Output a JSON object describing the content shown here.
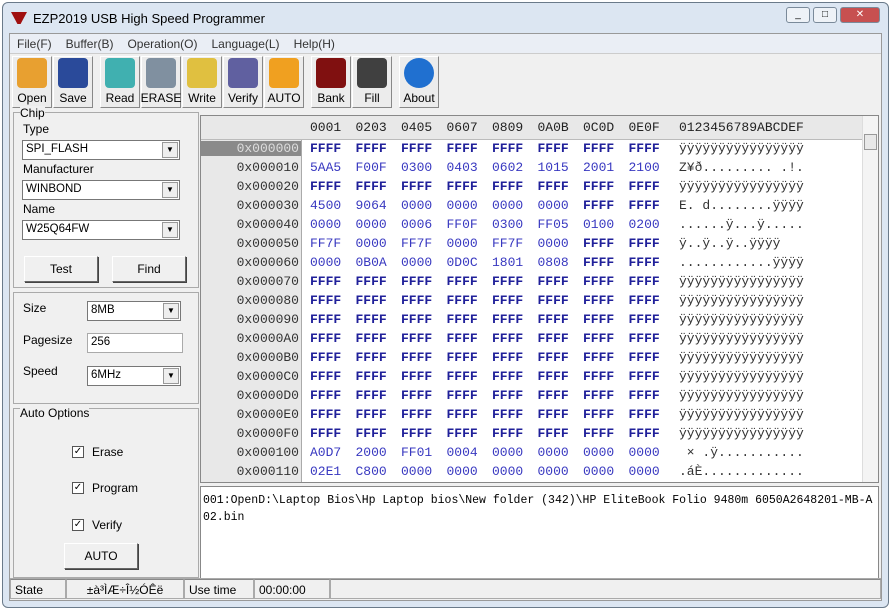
{
  "title": "EZP2019 USB High Speed Programmer",
  "window_controls": [
    "_",
    "□",
    "✕"
  ],
  "menu": [
    "File(F)",
    "Buffer(B)",
    "Operation(O)",
    "Language(L)",
    "Help(H)"
  ],
  "toolbar": [
    {
      "label": "Open",
      "icon": "folder-open-icon",
      "color": "#e8a030"
    },
    {
      "label": "Save",
      "icon": "floppy-disk-icon",
      "color": "#2a4a9a"
    },
    {
      "label": "Read",
      "icon": "notepad-icon",
      "color": "#40b0b0"
    },
    {
      "label": "ERASE",
      "icon": "trash-can-icon",
      "color": "#8090a0"
    },
    {
      "label": "Write",
      "icon": "folder-arrow-icon",
      "color": "#e0c040"
    },
    {
      "label": "Verify",
      "icon": "magnifier-icon",
      "color": "#6060a0"
    },
    {
      "label": "AUTO",
      "icon": "running-man-icon",
      "color": "#f0a020"
    },
    {
      "label": "Bank",
      "icon": "chip-info-icon",
      "color": "#801010"
    },
    {
      "label": "Fill",
      "icon": "bucket-icon",
      "color": "#404040"
    },
    {
      "label": "About",
      "icon": "help-icon",
      "color": "#2070d0"
    }
  ],
  "chip": {
    "group": "Chip",
    "type_label": "Type",
    "type": "SPI_FLASH",
    "manufacturer_label": "Manufacturer",
    "manufacturer": "WINBOND",
    "name_label": "Name",
    "name": "W25Q64FW",
    "test": "Test",
    "find": "Find"
  },
  "settings": {
    "size_label": "Size",
    "size": "8MB",
    "pagesize_label": "Pagesize",
    "pagesize": "256",
    "speed_label": "Speed",
    "speed": "6MHz"
  },
  "auto_options": {
    "group": "Auto Options",
    "erase": "Erase",
    "program": "Program",
    "verify": "Verify",
    "erase_checked": true,
    "program_checked": true,
    "verify_checked": true,
    "auto": "AUTO"
  },
  "hex": {
    "header_cols": [
      "0001",
      "0203",
      "0405",
      "0607",
      "0809",
      "0A0B",
      "0C0D",
      "0E0F"
    ],
    "header_ascii": "0123456789ABCDEF",
    "rows": [
      {
        "addr": "0x000000",
        "words": [
          "FFFF",
          "FFFF",
          "FFFF",
          "FFFF",
          "FFFF",
          "FFFF",
          "FFFF",
          "FFFF"
        ],
        "ascii": "ÿÿÿÿÿÿÿÿÿÿÿÿÿÿÿÿ"
      },
      {
        "addr": "0x000010",
        "words": [
          "5AA5",
          "F00F",
          "0300",
          "0403",
          "0602",
          "1015",
          "2001",
          "2100"
        ],
        "ascii": "Z¥ð......... .!."
      },
      {
        "addr": "0x000020",
        "words": [
          "FFFF",
          "FFFF",
          "FFFF",
          "FFFF",
          "FFFF",
          "FFFF",
          "FFFF",
          "FFFF"
        ],
        "ascii": "ÿÿÿÿÿÿÿÿÿÿÿÿÿÿÿÿ"
      },
      {
        "addr": "0x000030",
        "words": [
          "4500",
          "9064",
          "0000",
          "0000",
          "0000",
          "0000",
          "FFFF",
          "FFFF"
        ],
        "ascii": "E. d........ÿÿÿÿ"
      },
      {
        "addr": "0x000040",
        "words": [
          "0000",
          "0000",
          "0006",
          "FF0F",
          "0300",
          "FF05",
          "0100",
          "0200"
        ],
        "ascii": "......ÿ...ÿ....."
      },
      {
        "addr": "0x000050",
        "words": [
          "FF7F",
          "0000",
          "FF7F",
          "0000",
          "FF7F",
          "0000",
          "FFFF",
          "FFFF"
        ],
        "ascii": "ÿ..ÿ..ÿ..ÿÿÿÿ"
      },
      {
        "addr": "0x000060",
        "words": [
          "0000",
          "0B0A",
          "0000",
          "0D0C",
          "1801",
          "0808",
          "FFFF",
          "FFFF"
        ],
        "ascii": "............ÿÿÿÿ"
      },
      {
        "addr": "0x000070",
        "words": [
          "FFFF",
          "FFFF",
          "FFFF",
          "FFFF",
          "FFFF",
          "FFFF",
          "FFFF",
          "FFFF"
        ],
        "ascii": "ÿÿÿÿÿÿÿÿÿÿÿÿÿÿÿÿ"
      },
      {
        "addr": "0x000080",
        "words": [
          "FFFF",
          "FFFF",
          "FFFF",
          "FFFF",
          "FFFF",
          "FFFF",
          "FFFF",
          "FFFF"
        ],
        "ascii": "ÿÿÿÿÿÿÿÿÿÿÿÿÿÿÿÿ"
      },
      {
        "addr": "0x000090",
        "words": [
          "FFFF",
          "FFFF",
          "FFFF",
          "FFFF",
          "FFFF",
          "FFFF",
          "FFFF",
          "FFFF"
        ],
        "ascii": "ÿÿÿÿÿÿÿÿÿÿÿÿÿÿÿÿ"
      },
      {
        "addr": "0x0000A0",
        "words": [
          "FFFF",
          "FFFF",
          "FFFF",
          "FFFF",
          "FFFF",
          "FFFF",
          "FFFF",
          "FFFF"
        ],
        "ascii": "ÿÿÿÿÿÿÿÿÿÿÿÿÿÿÿÿ"
      },
      {
        "addr": "0x0000B0",
        "words": [
          "FFFF",
          "FFFF",
          "FFFF",
          "FFFF",
          "FFFF",
          "FFFF",
          "FFFF",
          "FFFF"
        ],
        "ascii": "ÿÿÿÿÿÿÿÿÿÿÿÿÿÿÿÿ"
      },
      {
        "addr": "0x0000C0",
        "words": [
          "FFFF",
          "FFFF",
          "FFFF",
          "FFFF",
          "FFFF",
          "FFFF",
          "FFFF",
          "FFFF"
        ],
        "ascii": "ÿÿÿÿÿÿÿÿÿÿÿÿÿÿÿÿ"
      },
      {
        "addr": "0x0000D0",
        "words": [
          "FFFF",
          "FFFF",
          "FFFF",
          "FFFF",
          "FFFF",
          "FFFF",
          "FFFF",
          "FFFF"
        ],
        "ascii": "ÿÿÿÿÿÿÿÿÿÿÿÿÿÿÿÿ"
      },
      {
        "addr": "0x0000E0",
        "words": [
          "FFFF",
          "FFFF",
          "FFFF",
          "FFFF",
          "FFFF",
          "FFFF",
          "FFFF",
          "FFFF"
        ],
        "ascii": "ÿÿÿÿÿÿÿÿÿÿÿÿÿÿÿÿ"
      },
      {
        "addr": "0x0000F0",
        "words": [
          "FFFF",
          "FFFF",
          "FFFF",
          "FFFF",
          "FFFF",
          "FFFF",
          "FFFF",
          "FFFF"
        ],
        "ascii": "ÿÿÿÿÿÿÿÿÿÿÿÿÿÿÿÿ"
      },
      {
        "addr": "0x000100",
        "words": [
          "A0D7",
          "2000",
          "FF01",
          "0004",
          "0000",
          "0000",
          "0000",
          "0000"
        ],
        "ascii": " × .ÿ..........."
      },
      {
        "addr": "0x000110",
        "words": [
          "02E1",
          "C800",
          "0000",
          "0000",
          "0000",
          "0000",
          "0000",
          "0000"
        ],
        "ascii": ".áÈ............."
      }
    ]
  },
  "log": "001:OpenD:\\Laptop Bios\\Hp Laptop bios\\New folder (342)\\HP EliteBook Folio 9480m 6050A2648201-MB-A02.bin",
  "status": {
    "state_label": "State",
    "state": "±à³ÌÆ÷Î½ÓÊë",
    "time_label": "Use time",
    "time": "00:00:00"
  }
}
